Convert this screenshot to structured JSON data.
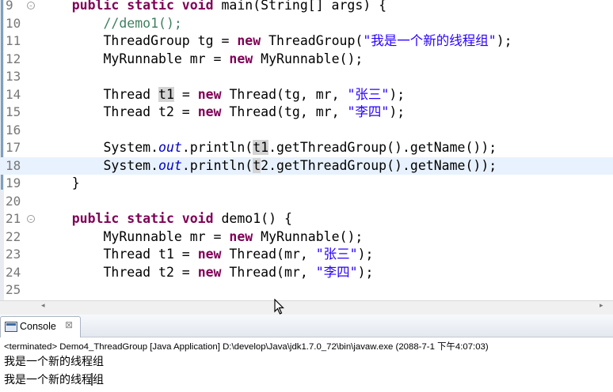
{
  "editor": {
    "lines": [
      {
        "num": "9",
        "fold": true,
        "tokens": [
          {
            "c": "kw",
            "t": "    public static void "
          },
          {
            "c": "",
            "t": "main(String[] args) {"
          }
        ]
      },
      {
        "num": "10",
        "tokens": [
          {
            "c": "",
            "t": "        "
          },
          {
            "c": "cm",
            "t": "//demo1();"
          }
        ]
      },
      {
        "num": "11",
        "tokens": [
          {
            "c": "",
            "t": "        ThreadGroup tg = "
          },
          {
            "c": "kw",
            "t": "new"
          },
          {
            "c": "",
            "t": " ThreadGroup("
          },
          {
            "c": "str",
            "t": "\"我是一个新的线程组\""
          },
          {
            "c": "",
            "t": ");"
          }
        ]
      },
      {
        "num": "12",
        "tokens": [
          {
            "c": "",
            "t": "        MyRunnable mr = "
          },
          {
            "c": "kw",
            "t": "new"
          },
          {
            "c": "",
            "t": " MyRunnable();"
          }
        ]
      },
      {
        "num": "13",
        "tokens": []
      },
      {
        "num": "14",
        "tokens": [
          {
            "c": "",
            "t": "        Thread "
          },
          {
            "c": "hl",
            "t": "t1"
          },
          {
            "c": "",
            "t": " = "
          },
          {
            "c": "kw",
            "t": "new"
          },
          {
            "c": "",
            "t": " Thread(tg, mr, "
          },
          {
            "c": "str",
            "t": "\"张三\""
          },
          {
            "c": "",
            "t": ");"
          }
        ]
      },
      {
        "num": "15",
        "tokens": [
          {
            "c": "",
            "t": "        Thread t2 = "
          },
          {
            "c": "kw",
            "t": "new"
          },
          {
            "c": "",
            "t": " Thread(tg, mr, "
          },
          {
            "c": "str",
            "t": "\"李四\""
          },
          {
            "c": "",
            "t": ");"
          }
        ]
      },
      {
        "num": "16",
        "tokens": []
      },
      {
        "num": "17",
        "tokens": [
          {
            "c": "",
            "t": "        System."
          },
          {
            "c": "it",
            "t": "out"
          },
          {
            "c": "",
            "t": ".println("
          },
          {
            "c": "hl",
            "t": "t1"
          },
          {
            "c": "",
            "t": ".getThreadGroup().getName());"
          }
        ]
      },
      {
        "num": "18",
        "current": true,
        "tokens": [
          {
            "c": "",
            "t": "        System."
          },
          {
            "c": "it",
            "t": "out"
          },
          {
            "c": "",
            "t": ".println("
          },
          {
            "c": "hl",
            "t": "t"
          },
          {
            "c": "",
            "t": "2.getThreadGroup().getName());"
          }
        ]
      },
      {
        "num": "19",
        "tokens": [
          {
            "c": "",
            "t": "    }"
          }
        ]
      },
      {
        "num": "20",
        "tokens": []
      },
      {
        "num": "21",
        "fold": true,
        "tokens": [
          {
            "c": "kw",
            "t": "    public static void "
          },
          {
            "c": "",
            "t": "demo1() {"
          }
        ]
      },
      {
        "num": "22",
        "tokens": [
          {
            "c": "",
            "t": "        MyRunnable mr = "
          },
          {
            "c": "kw",
            "t": "new"
          },
          {
            "c": "",
            "t": " MyRunnable();"
          }
        ]
      },
      {
        "num": "23",
        "tokens": [
          {
            "c": "",
            "t": "        Thread t1 = "
          },
          {
            "c": "kw",
            "t": "new"
          },
          {
            "c": "",
            "t": " Thread(mr, "
          },
          {
            "c": "str",
            "t": "\"张三\""
          },
          {
            "c": "",
            "t": ");"
          }
        ]
      },
      {
        "num": "24",
        "tokens": [
          {
            "c": "",
            "t": "        Thread t2 = "
          },
          {
            "c": "kw",
            "t": "new"
          },
          {
            "c": "",
            "t": " Thread(mr, "
          },
          {
            "c": "str",
            "t": "\"李四\""
          },
          {
            "c": "",
            "t": ");"
          }
        ]
      },
      {
        "num": "25",
        "tokens": []
      }
    ]
  },
  "console": {
    "tab_label": "Console",
    "close_glyph": "⊠",
    "status": "<terminated> Demo4_ThreadGroup [Java Application] D:\\develop\\Java\\jdk1.7.0_72\\bin\\javaw.exe (2088-7-1 下午4:07:03)",
    "output": [
      "我是一个新的线程组",
      "我是一个新的线程组"
    ]
  },
  "scrollbar": {
    "left_glyph": "◂",
    "right_glyph": "▸"
  },
  "icons": {
    "console": "console-icon",
    "fold": "fold-collapse-icon",
    "cursor": "mouse-pointer-icon"
  }
}
